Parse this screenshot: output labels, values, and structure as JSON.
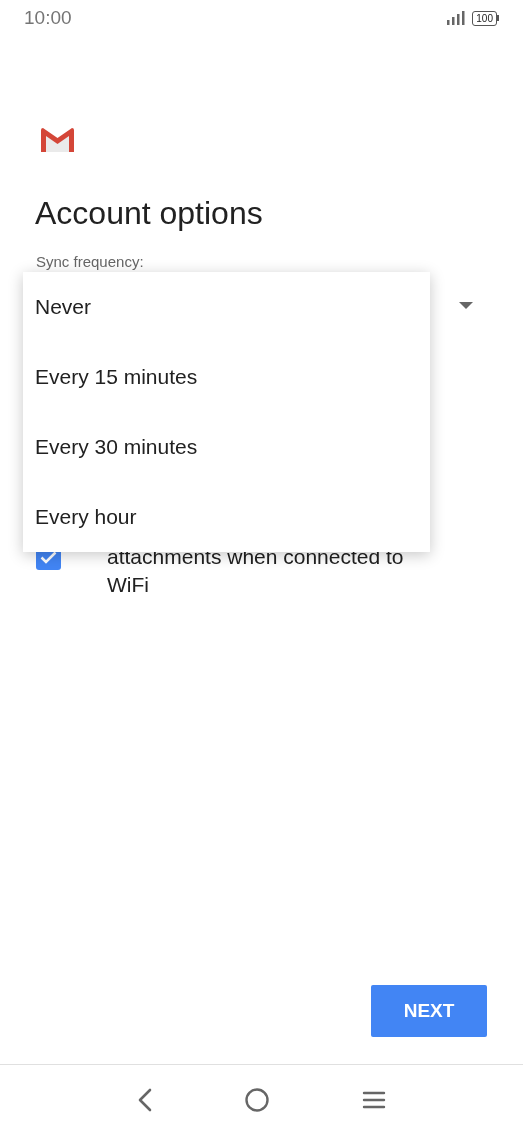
{
  "status_bar": {
    "time": "10:00",
    "battery": "100"
  },
  "title": "Account options",
  "sync_frequency": {
    "label": "Sync frequency:"
  },
  "menu": [
    {
      "label": "Never",
      "selected": false
    },
    {
      "label": "Every 15 minutes",
      "selected": false
    },
    {
      "label": "Every 30 minutes",
      "selected": false
    },
    {
      "label": "Every hour",
      "selected": false
    }
  ],
  "attachments_option": {
    "label": "attachments when connected to WiFi",
    "checked": true
  },
  "next_button": "NEXT"
}
